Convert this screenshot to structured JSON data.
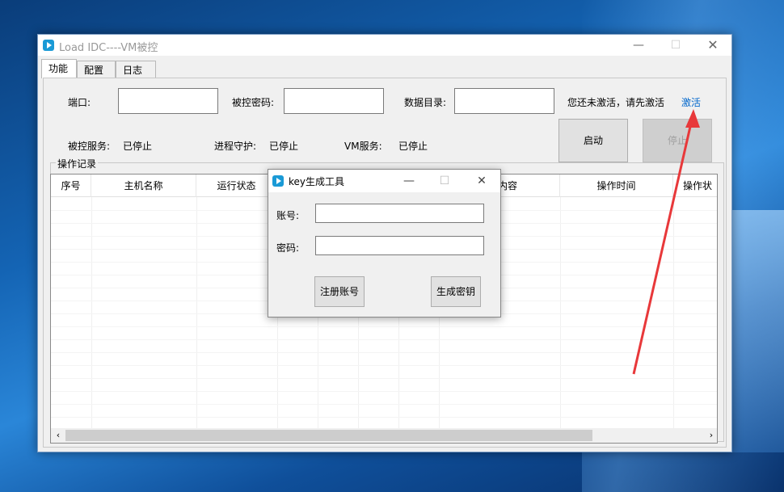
{
  "main_window": {
    "title": "Load IDC----VM被控",
    "controls": {
      "minimize": "—",
      "maximize": "☐",
      "close": "✕"
    }
  },
  "tabs": [
    {
      "label": "功能",
      "active": true
    },
    {
      "label": "配置",
      "active": false
    },
    {
      "label": "日志",
      "active": false
    }
  ],
  "settings": {
    "port_label": "端口:",
    "port_value": "",
    "password_label": "被控密码:",
    "password_value": "",
    "data_dir_label": "数据目录:",
    "data_dir_value": "",
    "activation_notice": "您还未激活，请先激活",
    "activate_link": "激活"
  },
  "status": {
    "controlled_service_label": "被控服务:",
    "controlled_service_value": "已停止",
    "process_guard_label": "进程守护:",
    "process_guard_value": "已停止",
    "vm_service_label": "VM服务:",
    "vm_service_value": "已停止"
  },
  "buttons": {
    "start": "启动",
    "stop": "停止"
  },
  "operation_log": {
    "group_title": "操作记录",
    "columns": [
      "序号",
      "主机名称",
      "运行状态",
      "",
      "",
      "",
      "内容",
      "操作时间",
      "操作状"
    ],
    "rows": []
  },
  "dialog": {
    "title": "key生成工具",
    "controls": {
      "minimize": "—",
      "maximize": "☐",
      "close": "✕"
    },
    "account_label": "账号:",
    "account_value": "",
    "password_label": "密码:",
    "password_value": "",
    "register_button": "注册账号",
    "generate_button": "生成密钥"
  },
  "scroll": {
    "left": "‹",
    "right": "›"
  },
  "annotation_color": "#e8383a"
}
